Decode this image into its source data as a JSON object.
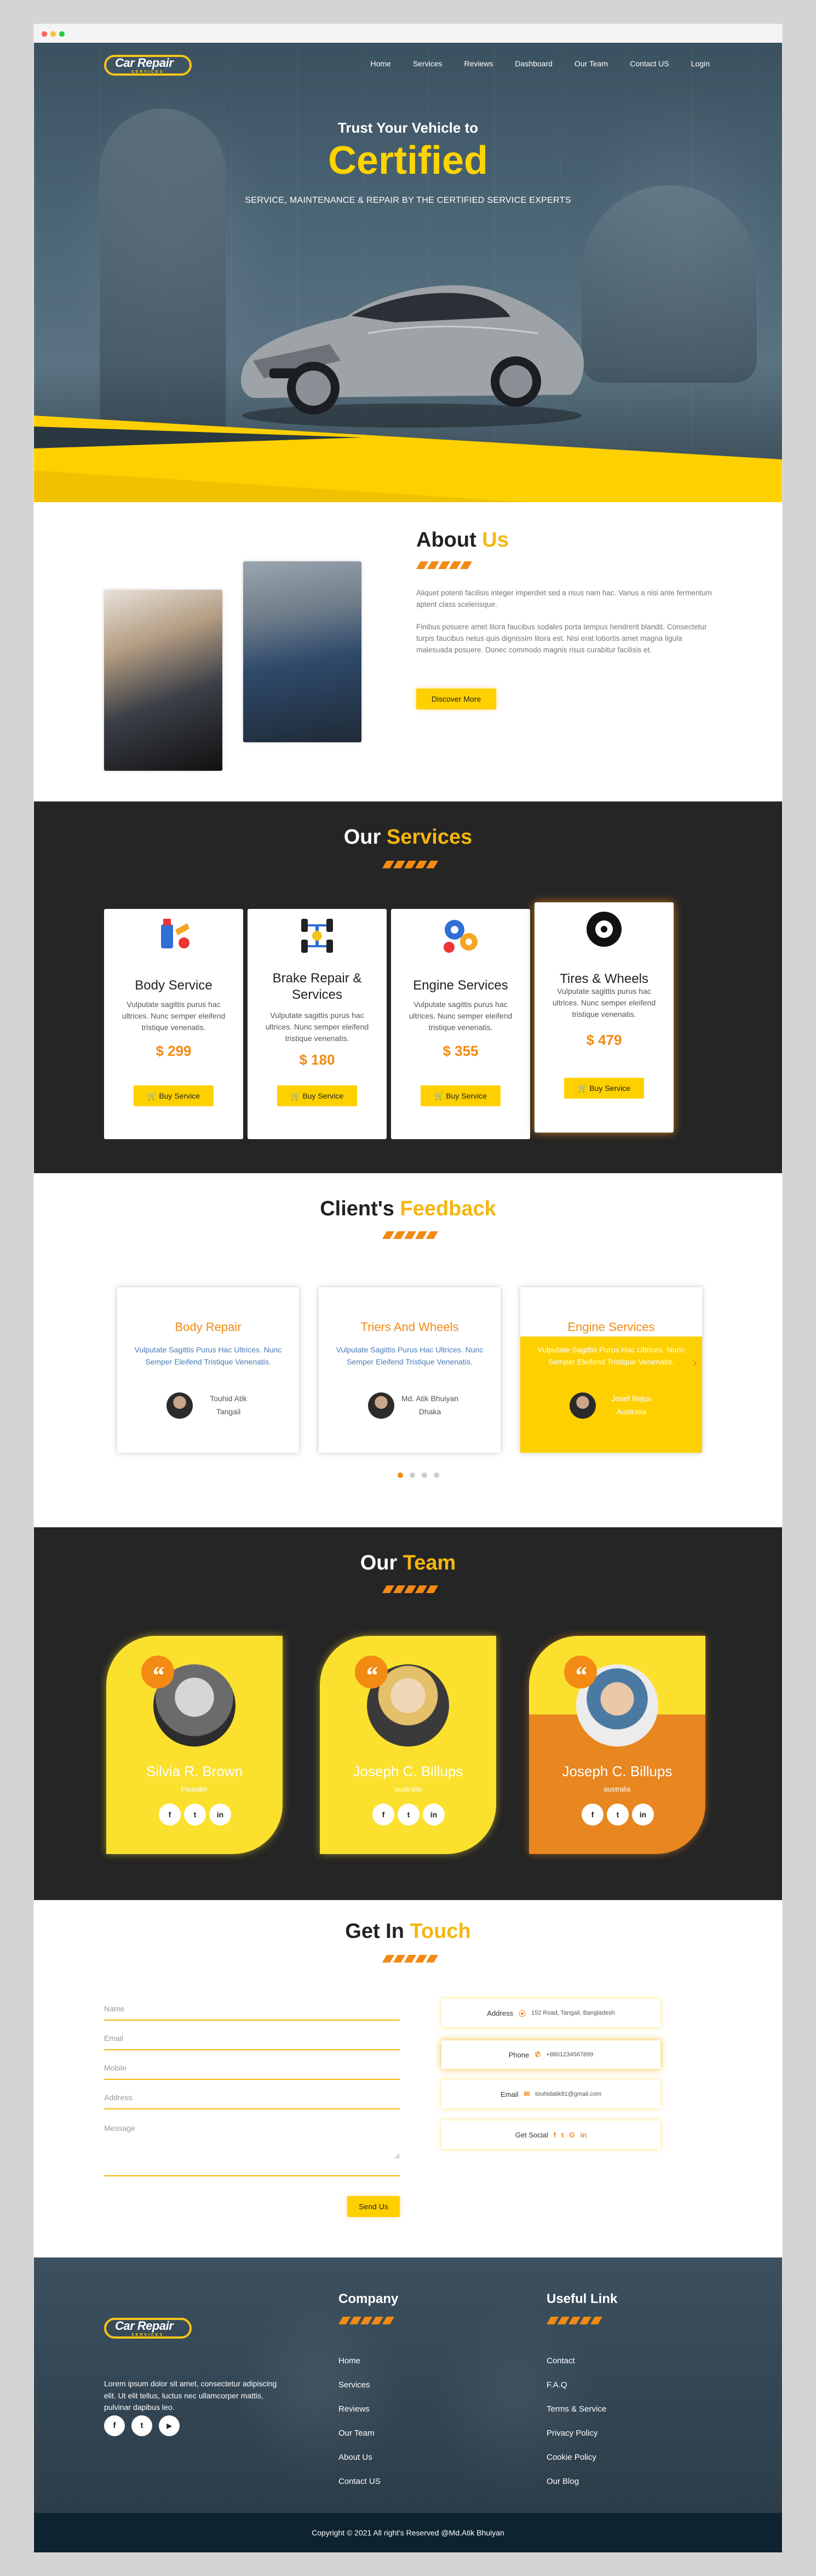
{
  "nav": {
    "logo_text": "Car Repair",
    "logo_sub": "SERVICES",
    "items": [
      "Home",
      "Services",
      "Reviews",
      "Dashboard",
      "Our Team",
      "Contact US",
      "Login"
    ]
  },
  "hero": {
    "pre": "Trust Your Vehicle to",
    "big": "Certified",
    "sub": "SERVICE, MAINTENANCE & REPAIR BY THE CERTIFIED SERVICE EXPERTS"
  },
  "about": {
    "title": "About",
    "title_hl": "Us",
    "p1": "Aliquet potenti facilisis integer imperdiet sed a risus nam hac. Varius a nisi ante fermentum aptent class scelerisque.",
    "p2": "Finibus posuere amet litora faucibus sodales porta tempus hendrerit blandit. Consectetur turpis faucibus netus quis dignissim litora est. Nisi erat lobortis amet magna ligula malesuada posuere. Donec commodo magnis risus curabitur facilisis et.",
    "button": "Discover More"
  },
  "services": {
    "title": "Our",
    "title_hl": "Services",
    "buy_label": "Buy Service",
    "cards": [
      {
        "title": "Body Service",
        "desc": "Vulputate sagittis purus hac ultrices. Nunc semper eleifend tristique venenatis.",
        "price": "$ 299"
      },
      {
        "title": "Brake Repair & Services",
        "desc": "Vulputate sagittis purus hac ultrices. Nunc semper eleifend tristique venenatis.",
        "price": "$ 180"
      },
      {
        "title": "Engine Services",
        "desc": "Vulputate sagittis purus hac ultrices. Nunc semper eleifend tristique venenatis.",
        "price": "$ 355"
      },
      {
        "title": "Tires & Wheels",
        "desc": "Vulputate sagittis purus hac ultrices. Nunc semper eleifend tristique venenatis.",
        "price": "$ 479"
      }
    ]
  },
  "feedback": {
    "title": "Client's",
    "title_hl": "Feedback",
    "cards": [
      {
        "title": "Body Repair",
        "desc": "Vulputate Sagittis Purus Hac Ultrices. Nunc Semper Eleifend Tristique Venenatis.",
        "name": "Touhid Atik",
        "place": "Tangail"
      },
      {
        "title": "Triers And Wheels",
        "desc": "Vulputate Sagittis Purus Hac Ultrices. Nunc Semper Eleifend Tristique Venenatis.",
        "name": "Md. Atik Bhuiyan",
        "place": "Dhaka"
      },
      {
        "title": "Engine Services",
        "desc": "Vulputate Sagittis Purus Hac Ultrices. Nunc Semper Eleifend Tristique Venenatis.",
        "name": "Josef Rejus",
        "place": "Australia"
      }
    ],
    "prev": "‹",
    "next": "›"
  },
  "team": {
    "title": "Our",
    "title_hl": "Team",
    "quote": "“",
    "members": [
      {
        "name": "Silvia R. Brown",
        "role": "Founder"
      },
      {
        "name": "Joseph C. Billups",
        "role": "australia"
      },
      {
        "name": "Joseph C. Billups",
        "role": "australia"
      }
    ],
    "social": [
      "f",
      "t",
      "in"
    ]
  },
  "contact": {
    "title": "Get In",
    "title_hl": "Touch",
    "placeholders": {
      "name": "Name",
      "email": "Email",
      "mobile": "Mobile",
      "address": "Address",
      "message": "Message"
    },
    "send": "Send Us",
    "info": [
      {
        "label": "Address",
        "icon": "location-icon",
        "value": "152 Road, Tangail, Bangladesh"
      },
      {
        "label": "Phone",
        "icon": "phone-icon",
        "value": "+8801234567899"
      },
      {
        "label": "Email",
        "icon": "mail-icon",
        "value": "touhidatik81@gmail.com"
      },
      {
        "label": "Get Social",
        "icon": "share-icon",
        "value": ""
      }
    ],
    "social": [
      "f",
      "t",
      "G",
      "in"
    ]
  },
  "footer": {
    "logo_text": "Car Repair",
    "logo_sub": "SERVICES",
    "blurb": "Lorem ipsum dolor sit amet, consectetur adipiscing elit. Ut elit tellus, luctus nec ullamcorper mattis, pulvinar dapibus leo.",
    "company_title": "Company",
    "company_links": [
      "Home",
      "Services",
      "Reviews",
      "Our Team",
      "About Us",
      "Contact US"
    ],
    "useful_title": "Useful Link",
    "useful_links": [
      "Contact",
      "F.A.Q",
      "Terms & Service",
      "Privacy Policy",
      "Cookie Policy",
      "Our Blog"
    ],
    "social": [
      "f",
      "t",
      "▶"
    ],
    "copyright": "Copyright © 2021 All right's Reserved @Md.Atik Bhuiyan"
  },
  "colors": {
    "accent": "#ffd000",
    "orange": "#f28a13",
    "dark": "#252525"
  }
}
